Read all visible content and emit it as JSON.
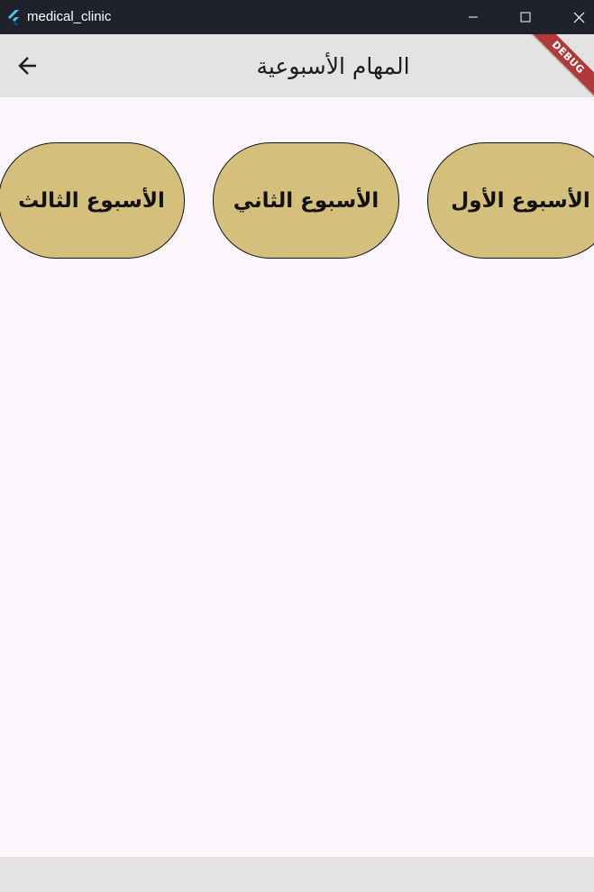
{
  "window": {
    "title": "medical_clinic",
    "icons": {
      "app": "flutter-logo-icon",
      "minimize": "minimize-icon",
      "maximize": "maximize-icon",
      "close": "close-icon"
    }
  },
  "appbar": {
    "title": "المهام الأسبوعية",
    "back_icon": "arrow-left-icon",
    "debug_banner": "DEBUG",
    "background": "#e3e3e3"
  },
  "weeks": [
    {
      "label": "الأسبوع الأول"
    },
    {
      "label": "الأسبوع الثاني"
    },
    {
      "label": "الأسبوع الثالث"
    }
  ],
  "colors": {
    "button_fill": "#d4c07c",
    "page_background": "#fcf6fc",
    "titlebar": "#1f222a",
    "debug_banner": "#b03a3a"
  }
}
